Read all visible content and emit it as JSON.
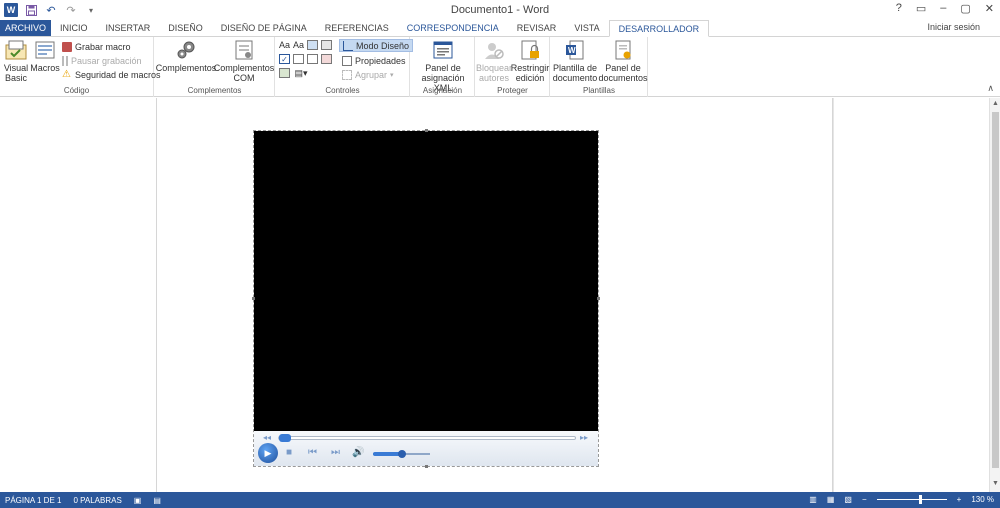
{
  "window": {
    "title": "Documento1 - Word",
    "controls": [
      "?",
      "▭",
      "–",
      "▢",
      "✕"
    ]
  },
  "qat": {
    "icons": [
      "word-logo-icon",
      "save-icon",
      "undo-icon",
      "redo-icon",
      "customize-icon"
    ]
  },
  "tabs": [
    {
      "label": "ARCHIVO",
      "kind": "file"
    },
    {
      "label": "INICIO"
    },
    {
      "label": "INSERTAR"
    },
    {
      "label": "DISEÑO"
    },
    {
      "label": "DISEÑO DE PÁGINA"
    },
    {
      "label": "REFERENCIAS"
    },
    {
      "label": "CORRESPONDENCIA",
      "kind": "accent"
    },
    {
      "label": "REVISAR"
    },
    {
      "label": "VISTA"
    },
    {
      "label": "DESARROLLADOR",
      "kind": "active"
    }
  ],
  "signin": "Iniciar sesión",
  "ribbon": {
    "codigo": {
      "label": "Código",
      "visual_basic": "Visual Basic",
      "macros": "Macros",
      "grabar_macro": "Grabar macro",
      "pausar_grabacion": "Pausar grabación",
      "seguridad_macros": "Seguridad de macros"
    },
    "complementos": {
      "label": "Complementos",
      "complementos": "Complementos",
      "complementos_com": "Complementos COM"
    },
    "controles": {
      "label": "Controles",
      "modo_diseno": "Modo Diseño",
      "propiedades": "Propiedades",
      "agrupar": "Agrupar"
    },
    "asignacion": {
      "label": "Asignación",
      "panel_xml": "Panel de asignación XML"
    },
    "proteger": {
      "label": "Proteger",
      "bloquear_autores": "Bloquear autores",
      "restringir_edicion": "Restringir edición"
    },
    "plantillas": {
      "label": "Plantillas",
      "plantilla_documento": "Plantilla de documento",
      "panel_documentos": "Panel de documentos"
    }
  },
  "player": {
    "progress": 0.0,
    "volume": 0.5
  },
  "statusbar": {
    "page": "PÁGINA 1 DE 1",
    "words": "0 PALABRAS",
    "zoom": "130 %",
    "zoom_minus": "−",
    "zoom_plus": "+",
    "zoom_value": 0.6
  }
}
